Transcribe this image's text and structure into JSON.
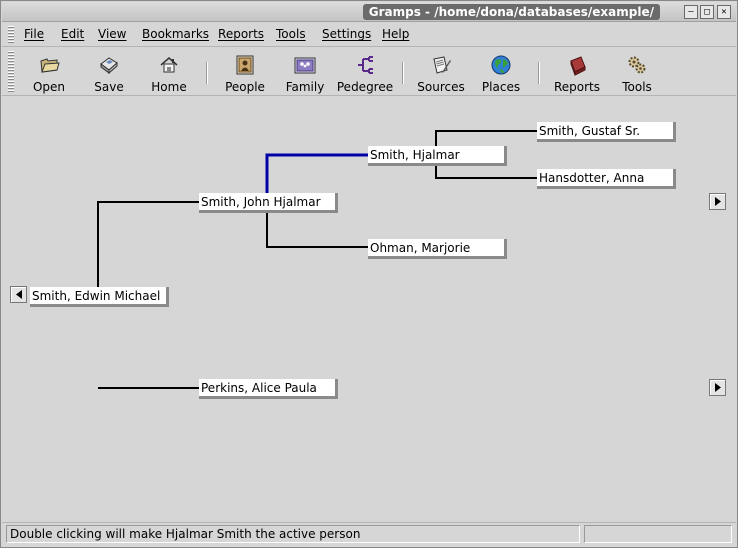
{
  "window": {
    "title": "Gramps - /home/dona/databases/example/"
  },
  "menubar": {
    "items": [
      {
        "label": "File"
      },
      {
        "label": "Edit"
      },
      {
        "label": "View"
      },
      {
        "label": "Bookmarks"
      },
      {
        "label": "Reports"
      },
      {
        "label": "Tools"
      },
      {
        "label": "Settings"
      },
      {
        "label": "Help"
      }
    ]
  },
  "toolbar": {
    "items": [
      {
        "label": "Open",
        "icon": "open-folder-icon"
      },
      {
        "label": "Save",
        "icon": "save-disk-icon"
      },
      {
        "label": "Home",
        "icon": "home-icon"
      },
      {
        "label": "People",
        "icon": "people-icon"
      },
      {
        "label": "Family",
        "icon": "family-icon"
      },
      {
        "label": "Pedegree",
        "icon": "pedigree-icon"
      },
      {
        "label": "Sources",
        "icon": "sources-icon"
      },
      {
        "label": "Places",
        "icon": "globe-icon"
      },
      {
        "label": "Reports",
        "icon": "book-icon"
      },
      {
        "label": "Tools",
        "icon": "gears-icon"
      }
    ]
  },
  "pedigree": {
    "active_person": "Smith, Edwin Michael",
    "father": "Smith, John Hjalmar",
    "mother": "Perkins, Alice Paula",
    "paternal_grandfather": "Smith, Hjalmar",
    "paternal_grandmother": "Ohman, Marjorie",
    "great_grandfather": "Smith, Gustaf Sr.",
    "great_grandmother": "Hansdotter, Anna",
    "highlight_color": "#0000a8"
  },
  "statusbar": {
    "message": "Double clicking will make Hjalmar Smith the active person"
  }
}
